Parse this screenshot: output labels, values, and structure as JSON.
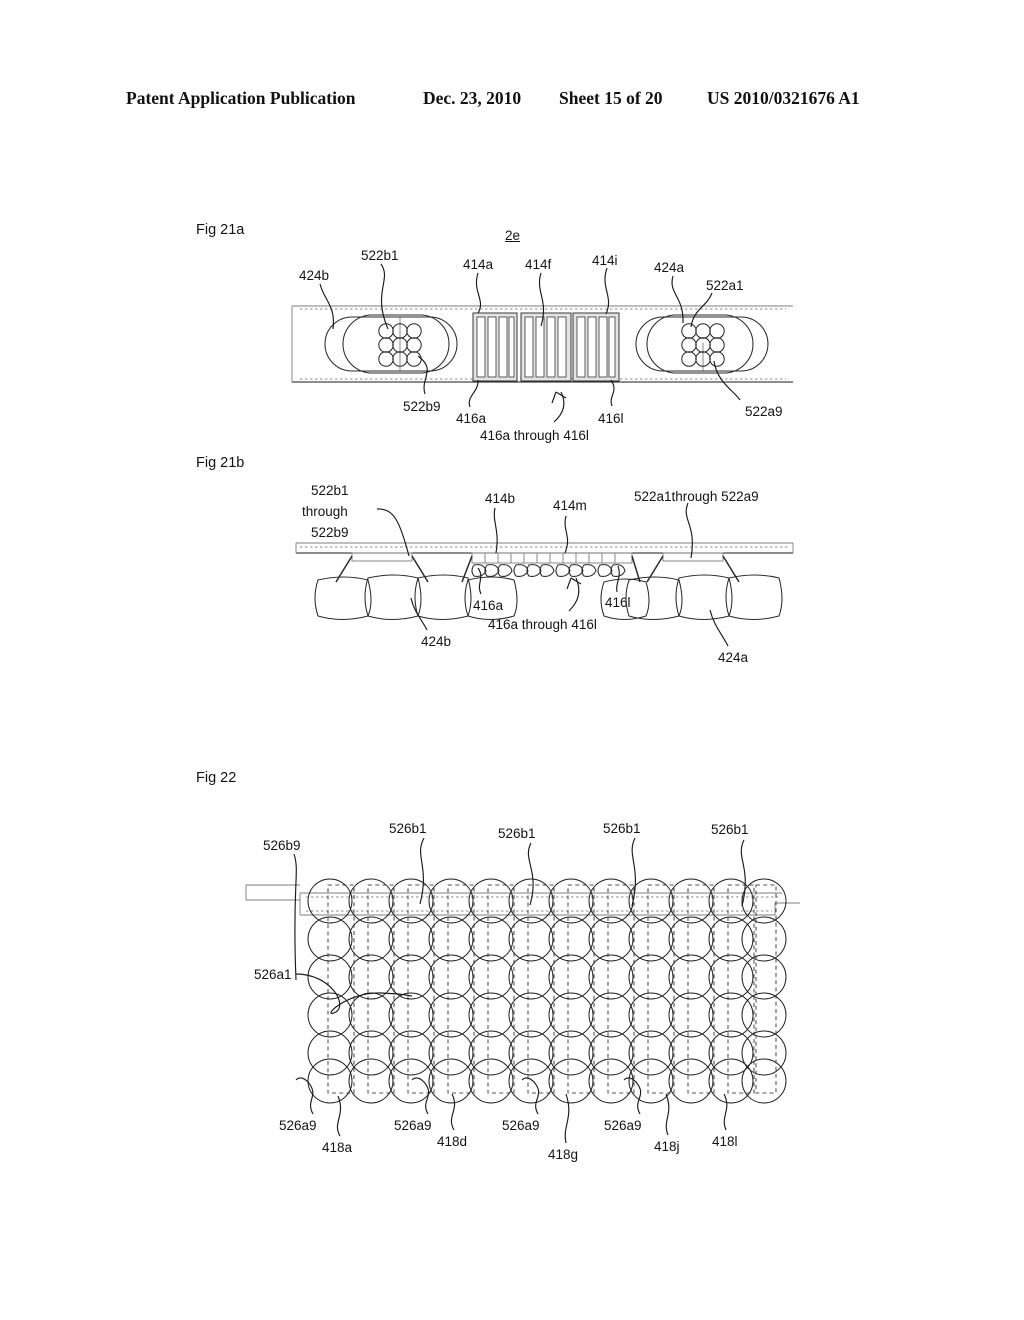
{
  "header": {
    "publication": "Patent Application Publication",
    "date": "Dec. 23, 2010",
    "sheet": "Sheet 15 of 20",
    "patent_number": "US 2010/0321676 A1"
  },
  "figures": [
    {
      "id": "fig21a",
      "caption": "Fig 21a",
      "assembly_label": "2e",
      "labels": {
        "left_pad": "424b",
        "left_coil_first": "522b1",
        "left_coil_last": "522b9",
        "center_first": "414a",
        "center_mid": "414f",
        "center_last": "414i",
        "core_first": "416a",
        "core_last": "416l",
        "core_range": "416a through 416l",
        "right_pad": "424a",
        "right_coil_first": "522a1",
        "right_coil_last": "522a9"
      }
    },
    {
      "id": "fig21b",
      "caption": "Fig 21b",
      "labels": {
        "left_coil_range_line1": "522b1",
        "left_coil_range_line2": "through",
        "left_coil_range_line3": "522b9",
        "center_first": "414b",
        "center_last": "414m",
        "right_coil_range": "522a1through 522a9",
        "core_first": "416a",
        "core_last": "416l",
        "core_range": "416a through 416l",
        "left_pad": "424b",
        "right_pad": "424a"
      }
    },
    {
      "id": "fig22",
      "caption": "Fig 22",
      "labels": {
        "top_left": "526b9",
        "top_1": "526b1",
        "top_2": "526b1",
        "top_3": "526b1",
        "top_4": "526b1",
        "mid_left": "526a1",
        "bottom_1": "526a9",
        "bottom_2": "526a9",
        "bottom_3": "526a9",
        "bottom_4": "526a9",
        "coil_a": "418a",
        "coil_d": "418d",
        "coil_g": "418g",
        "coil_j": "418j",
        "coil_l": "418l"
      },
      "grid": {
        "columns": 12,
        "rows": 6
      }
    }
  ]
}
